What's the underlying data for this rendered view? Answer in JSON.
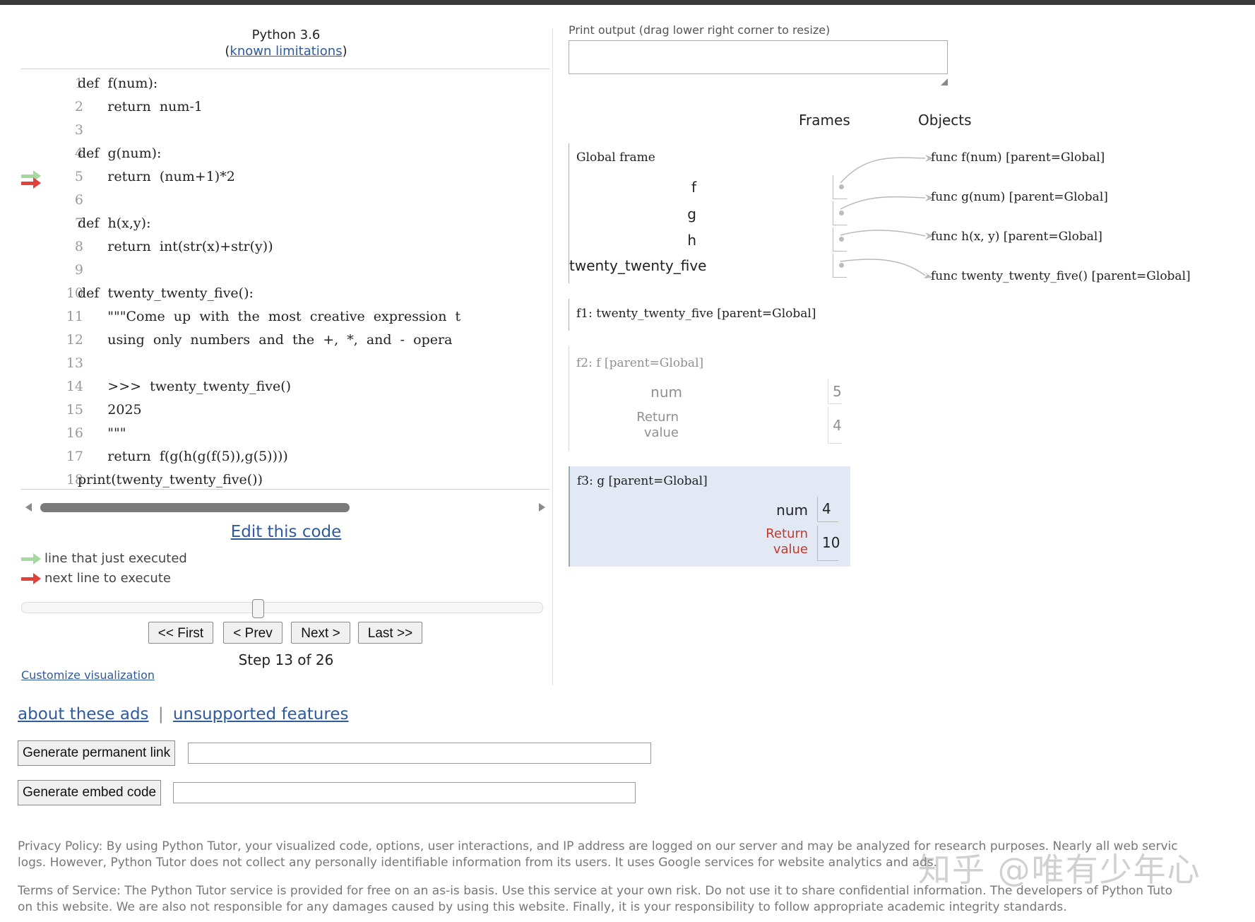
{
  "header": {
    "language": "Python 3.6",
    "limitations_prefix": "(",
    "limitations_link": "known limitations",
    "limitations_suffix": ")"
  },
  "code": {
    "lines": [
      {
        "num": "1",
        "text": "def  f(num):"
      },
      {
        "num": "2",
        "text": "       return  num-1"
      },
      {
        "num": "3",
        "text": ""
      },
      {
        "num": "4",
        "text": "def  g(num):"
      },
      {
        "num": "5",
        "text": "       return  (num+1)*2"
      },
      {
        "num": "6",
        "text": ""
      },
      {
        "num": "7",
        "text": "def  h(x,y):"
      },
      {
        "num": "8",
        "text": "       return  int(str(x)+str(y))"
      },
      {
        "num": "9",
        "text": ""
      },
      {
        "num": "10",
        "text": "def  twenty_twenty_five():"
      },
      {
        "num": "11",
        "text": "       \"\"\"Come  up  with  the  most  creative  expression  t"
      },
      {
        "num": "12",
        "text": "       using  only  numbers  and  the  +,  *,  and  -  opera"
      },
      {
        "num": "13",
        "text": ""
      },
      {
        "num": "14",
        "text": "       >>>  twenty_twenty_five()"
      },
      {
        "num": "15",
        "text": "       2025"
      },
      {
        "num": "16",
        "text": "       \"\"\""
      },
      {
        "num": "17",
        "text": "       return  f(g(h(g(f(5)),g(5))))"
      },
      {
        "num": "18",
        "text": "print(twenty_twenty_five())"
      }
    ],
    "current_line": 5,
    "colors": {
      "just_executed": "#a6d9a2",
      "next_to_execute": "#e2403a"
    }
  },
  "controls": {
    "edit_link": "Edit this code",
    "legend_just_executed": "line that just executed",
    "legend_next": "next line to execute",
    "first": "<< First",
    "prev": "< Prev",
    "next": "Next >",
    "last": "Last >>",
    "step_label": "Step 13 of 26",
    "step_current": 13,
    "step_total": 26,
    "customize": "Customize visualization"
  },
  "output": {
    "label": "Print output (drag lower right corner to resize)",
    "value": ""
  },
  "viz": {
    "frames_heading": "Frames",
    "objects_heading": "Objects",
    "global_frame": {
      "title": "Global frame",
      "vars": [
        "f",
        "g",
        "h",
        "twenty_twenty_five"
      ]
    },
    "objects": [
      "func f(num)  [parent=Global]",
      "func g(num)  [parent=Global]",
      "func h(x,  y)  [parent=Global]",
      "func twenty_twenty_five()  [parent=Global]"
    ],
    "f1": {
      "title": "f1: twenty_twenty_five [parent=Global]"
    },
    "f2": {
      "title": "f2: f [parent=Global]",
      "num_label": "num",
      "num_value": "5",
      "return_label_1": "Return",
      "return_label_2": "value",
      "return_value": "4"
    },
    "f3": {
      "title": "f3: g [parent=Global]",
      "num_label": "num",
      "num_value": "4",
      "return_label_1": "Return",
      "return_label_2": "value",
      "return_value": "10",
      "highlight_color": "#e2e9f5",
      "return_label_color": "#c0392b"
    }
  },
  "bottom": {
    "about_ads": "about these ads",
    "separator": "|",
    "unsupported": "unsupported features",
    "permalink_button": "Generate permanent link",
    "permalink_value": "",
    "embed_button": "Generate embed code",
    "embed_value": "",
    "privacy_1": "Privacy Policy: By using Python Tutor, your visualized code, options, user interactions, and IP address are logged on our server and may be analyzed for research purposes. Nearly all web servic",
    "privacy_2": "logs. However, Python Tutor does not collect any personally identifiable information from its users. It uses Google services for website analytics and ads.",
    "terms_1": "Terms of Service: The Python Tutor service is provided for free on an as-is basis. Use this service at your own risk. Do not use it to share confidential information. The developers of Python Tuto",
    "terms_2": "on this website. We are also not responsible for any damages caused by using this website. Finally, it is your responsibility to follow appropriate academic integrity standards.",
    "watermark": "知乎 @唯有少年心"
  }
}
